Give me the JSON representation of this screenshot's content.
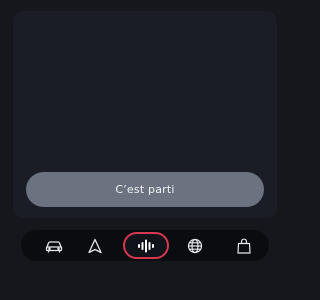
{
  "cta": {
    "label": "C’est parti"
  },
  "nav": {
    "items": [
      {
        "name": "car",
        "icon": "car-icon",
        "selected": false
      },
      {
        "name": "navigation",
        "icon": "navigation-arrow-icon",
        "selected": false
      },
      {
        "name": "voice",
        "icon": "voice-waveform-icon",
        "selected": true
      },
      {
        "name": "globe",
        "icon": "globe-icon",
        "selected": false
      },
      {
        "name": "shop",
        "icon": "shopping-bag-icon",
        "selected": false
      }
    ]
  },
  "colors": {
    "background": "#15171d",
    "card": "#1a1d25",
    "button": "#6b7280",
    "navbar": "#0b0c10",
    "accent": "#d5384f",
    "icon": "#e6e7ea"
  }
}
